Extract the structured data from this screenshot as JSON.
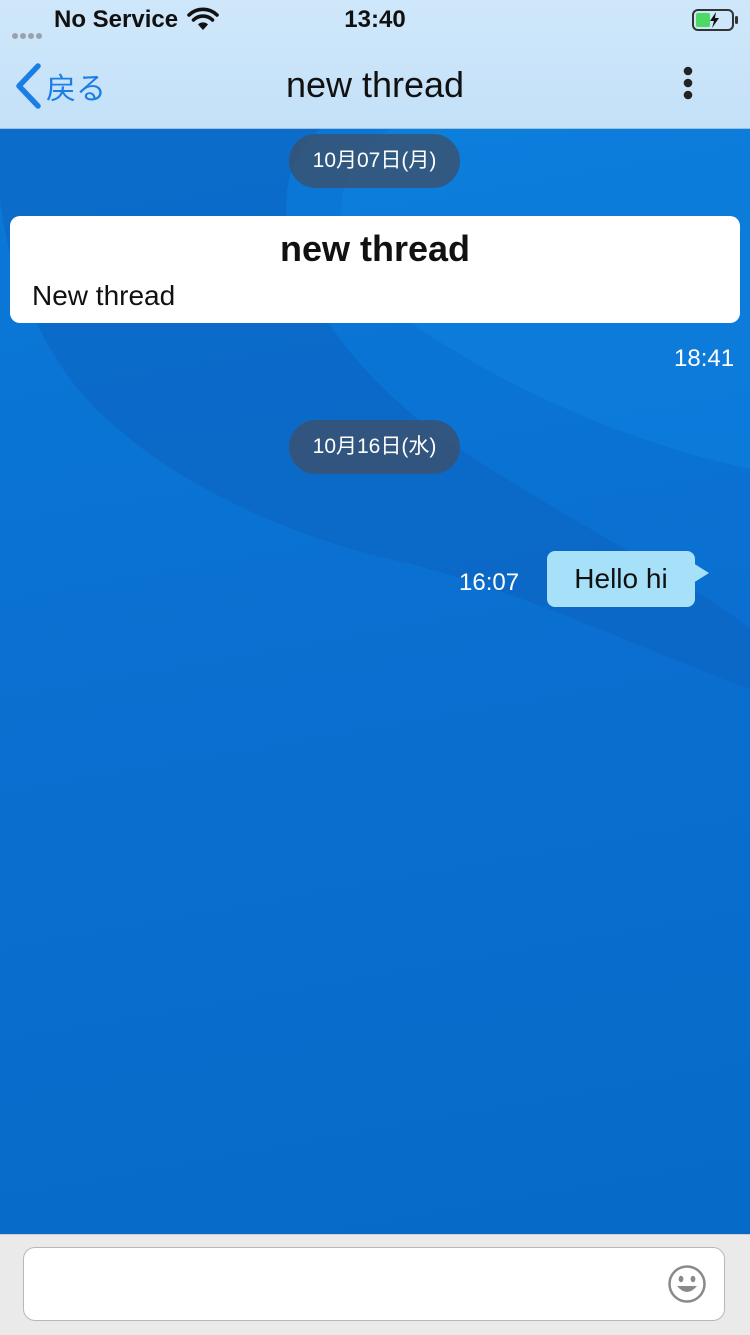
{
  "status_bar": {
    "carrier": "No Service",
    "time": "13:40"
  },
  "nav": {
    "back_label": "戻る",
    "title": "new thread",
    "back_icon": "chevron-left-icon",
    "menu_icon": "more-vertical-icon"
  },
  "chat": {
    "date_1": "10月07日(月)",
    "card": {
      "title": "new thread",
      "body": "New thread"
    },
    "card_time": "18:41",
    "date_2": "10月16日(水)",
    "message": {
      "time": "16:07",
      "text": "Hello hi"
    }
  },
  "composer": {
    "value": "",
    "placeholder": "",
    "emoji_icon": "smiley-icon"
  },
  "colors": {
    "accent": "#1b7de6",
    "chat_background": "#0a6fd1",
    "bubble": "#a6e0f9",
    "date_pill": "#3c5069",
    "battery_fill": "#4cd964"
  }
}
